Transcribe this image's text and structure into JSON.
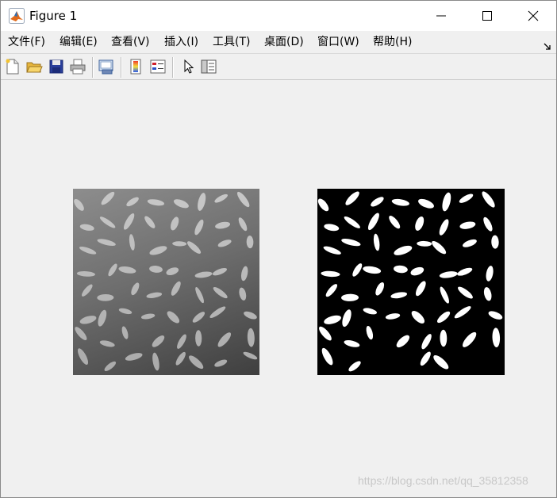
{
  "window": {
    "title": "Figure 1",
    "icon": "matlab-icon"
  },
  "menu": {
    "items": [
      {
        "label": "文件(F)"
      },
      {
        "label": "编辑(E)"
      },
      {
        "label": "查看(V)"
      },
      {
        "label": "插入(I)"
      },
      {
        "label": "工具(T)"
      },
      {
        "label": "桌面(D)"
      },
      {
        "label": "窗口(W)"
      },
      {
        "label": "帮助(H)"
      }
    ]
  },
  "toolbar": {
    "buttons": [
      "new-figure-icon",
      "open-file-icon",
      "save-figure-icon",
      "print-figure-icon",
      "link-plot-icon",
      "insert-colorbar-icon",
      "insert-legend-icon",
      "edit-plot-arrow-icon",
      "show-plot-tools-icon"
    ]
  },
  "figure": {
    "images": [
      {
        "name": "grayscale-rice-image",
        "colormap": "gray"
      },
      {
        "name": "binary-rice-image",
        "colormap": "binary"
      }
    ]
  },
  "watermark": {
    "text": "https://blog.csdn.net/qq_35812358"
  },
  "colors": {
    "background": "#f0f0f0",
    "titlebar": "#ffffff"
  }
}
